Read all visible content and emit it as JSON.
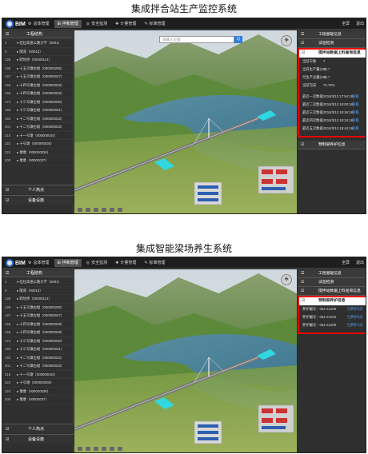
{
  "captions": {
    "top": "集成拌合站生产监控系统",
    "bottom": "集成智能梁场养生系统"
  },
  "screens": [
    {
      "logo": "BIM",
      "nav": [
        {
          "icon": "⚙",
          "label": "总体管理"
        },
        {
          "icon": "⊞",
          "label": "拌和管理"
        },
        {
          "icon": "◎",
          "label": "安全监测"
        },
        {
          "icon": "✚",
          "label": "计量管理"
        },
        {
          "icon": "✎",
          "label": "标准管理"
        }
      ],
      "active_nav": 1,
      "top_right": [
        "全屏",
        "退出"
      ],
      "search_placeholder": "请输入位置",
      "search_button": "Q",
      "sidebar_title": "工程结构",
      "tree": [
        {
          "id": "1",
          "name": "▾ 桂拉高速公路大学（6001）"
        },
        {
          "id": "0",
          "name": "▸ 隧道（00013）"
        },
        {
          "id": "135",
          "name": "▸ 跨坑桥（00000114）"
        },
        {
          "id": "136",
          "name": "▸ 十五号墩右幅（000000205）"
        },
        {
          "id": "147",
          "name": "▸ 十五号墩左幅（000000027）"
        },
        {
          "id": "156",
          "name": "▸ 十四号墩左幅（000000028）"
        },
        {
          "id": "165",
          "name": "▸ 十四号墩右幅（000000028）"
        },
        {
          "id": "174",
          "name": "▸ 十三号墩左幅（000000030）"
        },
        {
          "id": "183",
          "name": "▸ 十三号墩右幅（000000031）"
        },
        {
          "id": "192",
          "name": "▸ 十二号墩左幅（000000032）"
        },
        {
          "id": "201",
          "name": "▸ 十二号墩右幅（000000033）"
        },
        {
          "id": "210",
          "name": "▸ 十一号墩（000000034）"
        },
        {
          "id": "222",
          "name": "▸ 十号墩（000000035）"
        },
        {
          "id": "224",
          "name": "▸ 墩墩（000000036）"
        },
        {
          "id": "200",
          "name": "▸ 墩墩（00000037）"
        }
      ],
      "side_footer": [
        {
          "icon": "☑",
          "label": "个人热点"
        },
        {
          "icon": "☑",
          "label": "设备设施"
        }
      ],
      "right_heads": [
        {
          "icon": "☰",
          "label": "工程基础信息"
        },
        {
          "icon": "☑",
          "label": "试验检测"
        }
      ],
      "box_title": "搅拌站数据上料查询信息",
      "box_rows": [
        {
          "k": "当前车数",
          "v": "7",
          "link": ""
        },
        {
          "k": "当日生产量(m³)",
          "v": "25.7",
          "link": ""
        },
        {
          "k": "月生产总量(m³)",
          "v": "18.7",
          "link": ""
        },
        {
          "k": "当前完成",
          "v": "72.79%",
          "link": ""
        },
        {
          "k": "",
          "v": "",
          "link": ""
        },
        {
          "k": "最近一次数据",
          "v": "2018/3/13 17:54:18",
          "link": "查看"
        },
        {
          "k": "最近二次数据",
          "v": "2018/3/13 18:00:18",
          "link": "查看"
        },
        {
          "k": "最近三次数据",
          "v": "2018/3/13 18:16:18",
          "link": "查看"
        },
        {
          "k": "最近四次数据",
          "v": "2018/3/13 18:34:18",
          "link": "查看"
        },
        {
          "k": "最近五次数据",
          "v": "2018/3/13 18:44:18",
          "link": "查看"
        }
      ],
      "right_foot": [
        {
          "icon": "☑",
          "label": "预制梁养护信息"
        }
      ]
    },
    {
      "logo": "BIM",
      "nav": [
        {
          "icon": "⚙",
          "label": "总体管理"
        },
        {
          "icon": "⊞",
          "label": "拌和管理"
        },
        {
          "icon": "◎",
          "label": "安全监测"
        },
        {
          "icon": "✚",
          "label": "计量管理"
        },
        {
          "icon": "✎",
          "label": "标准管理"
        }
      ],
      "active_nav": 1,
      "top_right": [
        "全屏",
        "退出"
      ],
      "search_placeholder": "",
      "search_button": "",
      "sidebar_title": "工程结构",
      "tree": [
        {
          "id": "1",
          "name": "▾ 桂拉高速公路大学（6001）"
        },
        {
          "id": "0",
          "name": "▸ 隧道（00013）"
        },
        {
          "id": "135",
          "name": "▸ 跨坑桥（00000114）"
        },
        {
          "id": "136",
          "name": "▸ 十五号墩右幅（000000205）"
        },
        {
          "id": "147",
          "name": "▸ 十五号墩左幅（000000027）"
        },
        {
          "id": "156",
          "name": "▸ 十四号墩左幅（000000028）"
        },
        {
          "id": "165",
          "name": "▸ 十四号墩右幅（000000028）"
        },
        {
          "id": "174",
          "name": "▸ 十三号墩左幅（000000030）"
        },
        {
          "id": "183",
          "name": "▸ 十三号墩右幅（000000031）"
        },
        {
          "id": "192",
          "name": "▸ 十二号墩左幅（000000032）"
        },
        {
          "id": "201",
          "name": "▸ 十二号墩右幅（000000033）"
        },
        {
          "id": "218",
          "name": "▸ 十一号墩（000000034）"
        },
        {
          "id": "222",
          "name": "▸ 十号墩（000000035）"
        },
        {
          "id": "224",
          "name": "▸ 墩墩（000000036）"
        },
        {
          "id": "200",
          "name": "▸ 墩墩（00000037）"
        }
      ],
      "side_footer": [
        {
          "icon": "☑",
          "label": "个人热点"
        },
        {
          "icon": "☑",
          "label": "设备设施"
        }
      ],
      "right_heads": [
        {
          "icon": "☰",
          "label": "工程基础信息"
        },
        {
          "icon": "☑",
          "label": "试验检测"
        },
        {
          "icon": "☑",
          "label": "搅拌站数据上料查询信息"
        }
      ],
      "box_title": "预制梁养护信息",
      "box_rows": [
        {
          "k": "养护编号：004-22108",
          "v": "",
          "link": "已养护0天"
        },
        {
          "k": "养护编号：004-22103",
          "v": "",
          "link": "已养护0天"
        },
        {
          "k": "养护编号：004-22109",
          "v": "",
          "link": "已养护1天"
        }
      ],
      "right_foot": []
    }
  ]
}
